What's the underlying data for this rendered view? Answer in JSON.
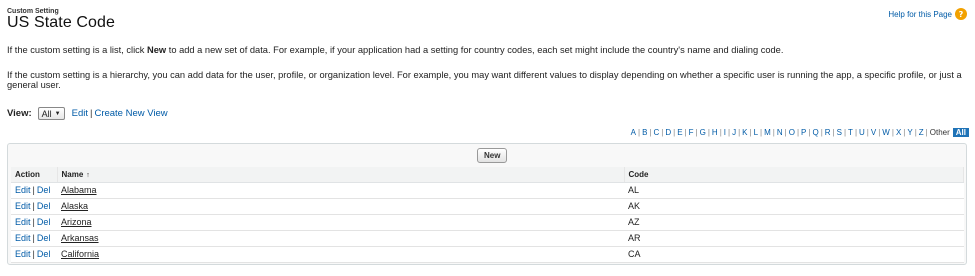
{
  "header": {
    "subtitle": "Custom Setting",
    "title": "US State Code",
    "help_link": "Help for this Page",
    "help_icon": "help-icon"
  },
  "description": {
    "line1_pre": "If the custom setting is a list, click ",
    "line1_bold": "New",
    "line1_post": " to add a new set of data. For example, if your application had a setting for country codes, each set might include the country's name and dialing code.",
    "line2": "If the custom setting is a hierarchy, you can add data for the user, profile, or organization level. For example, you may want different values to display depending on whether a specific user is running the app, a specific profile, or just a general user."
  },
  "view": {
    "label": "View:",
    "selected": "All",
    "edit_link": "Edit",
    "separator": "|",
    "create_link": "Create New View"
  },
  "alphabet": {
    "letters": [
      "A",
      "B",
      "C",
      "D",
      "E",
      "F",
      "G",
      "H",
      "I",
      "J",
      "K",
      "L",
      "M",
      "N",
      "O",
      "P",
      "Q",
      "R",
      "S",
      "T",
      "U",
      "V",
      "W",
      "X",
      "Y",
      "Z"
    ],
    "other": "Other",
    "all": "All"
  },
  "list": {
    "new_button": "New",
    "columns": {
      "action": "Action",
      "name": "Name",
      "code": "Code"
    },
    "sort_indicator": "↑",
    "edit_label": "Edit",
    "separator": "|",
    "del_label": "Del",
    "rows": [
      {
        "name": "Alabama",
        "code": "AL"
      },
      {
        "name": "Alaska",
        "code": "AK"
      },
      {
        "name": "Arizona",
        "code": "AZ"
      },
      {
        "name": "Arkansas",
        "code": "AR"
      },
      {
        "name": "California",
        "code": "CA"
      }
    ]
  },
  "colors": {
    "link": "#015ba7",
    "help_icon": "#f2a100",
    "all_highlight": "#1f73b7",
    "header_row": "#f2f3f3"
  }
}
